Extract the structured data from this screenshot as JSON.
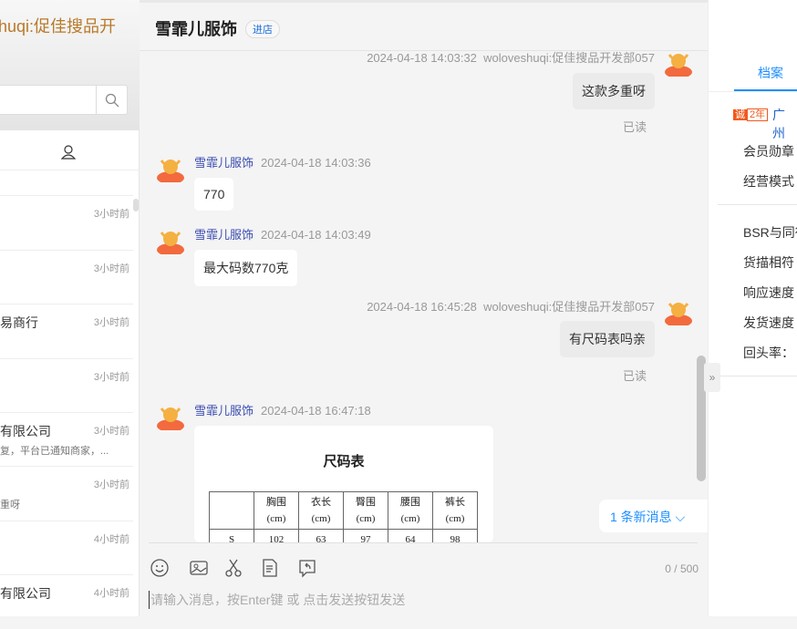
{
  "left": {
    "title": "huqi:促佳搜品开",
    "items": [
      {
        "name": "",
        "time": "3小时前",
        "preview": ""
      },
      {
        "name": "",
        "time": "3小时前",
        "preview": ""
      },
      {
        "name": "易商行",
        "time": "3小时前",
        "preview": ""
      },
      {
        "name": "",
        "time": "3小时前",
        "preview": ""
      },
      {
        "name": "有限公司",
        "time": "3小时前",
        "preview": "复，平台已通知商家，..."
      },
      {
        "name": "",
        "time": "3小时前",
        "preview": "重呀"
      },
      {
        "name": "",
        "time": "4小时前",
        "preview": ""
      },
      {
        "name": "有限公司",
        "time": "4小时前",
        "preview": ""
      }
    ]
  },
  "chat": {
    "shop_name": "雪霏儿服饰",
    "enter_store": "进店",
    "messages": [
      {
        "sender": "woloveshuqi:促佳搜品开发部057",
        "time": "2024-04-18 14:03:32",
        "text": "这款多重呀",
        "status": "已读"
      },
      {
        "sender": "雪霏儿服饰",
        "time": "2024-04-18 14:03:36",
        "text": "770"
      },
      {
        "sender": "雪霏儿服饰",
        "time": "2024-04-18 14:03:49",
        "text": "最大码数770克"
      },
      {
        "sender": "woloveshuqi:促佳搜品开发部057",
        "time": "2024-04-18 16:45:28",
        "text": "有尺码表吗亲",
        "status": "已读"
      },
      {
        "sender": "雪霏儿服饰",
        "time": "2024-04-18 16:47:18"
      }
    ],
    "size_chart": {
      "title": "尺码表",
      "headers": [
        "",
        "胸围",
        "衣长",
        "臀围",
        "腰围",
        "裤长"
      ],
      "unit": "(cm)",
      "rows": [
        [
          "S",
          "102",
          "63",
          "97",
          "64",
          "98"
        ]
      ]
    },
    "new_messages": "1 条新消息",
    "counter": "0 / 500",
    "placeholder": "请输入消息，按Enter键 或 点击发送按钮发送"
  },
  "right": {
    "tab": "档案",
    "badge_cheng": "诚",
    "badge_years": "2年",
    "city": "广州",
    "rows": [
      "会员勋章",
      "经营模式",
      "BSR与同行",
      "货描相符",
      "响应速度",
      "发货速度",
      "回头率："
    ]
  }
}
